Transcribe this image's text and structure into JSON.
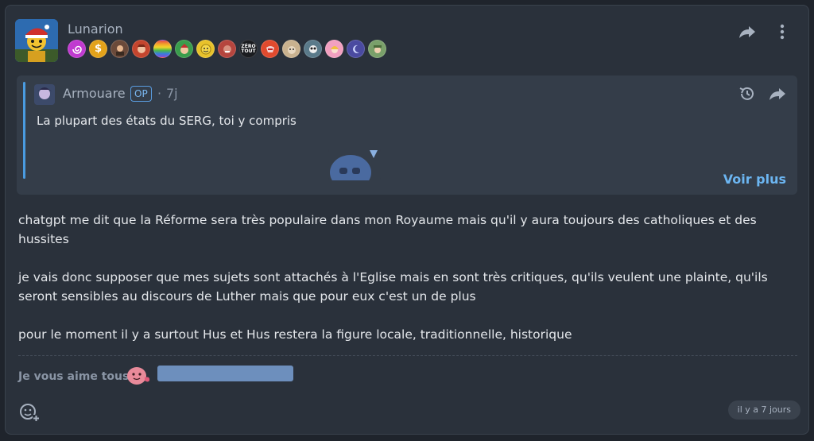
{
  "post": {
    "author": "Lunarion",
    "badges": [
      {
        "icon": "spiral-badge",
        "color": "#c03ad0",
        "label": ""
      },
      {
        "icon": "dollar-badge",
        "color": "#e3a21a",
        "label": "$"
      },
      {
        "icon": "soldier-badge",
        "color": "#6b4a3a",
        "label": ""
      },
      {
        "icon": "warrior-badge",
        "color": "#c4452e",
        "label": ""
      },
      {
        "icon": "rainbow-badge",
        "color": "#e5484d",
        "label": ""
      },
      {
        "icon": "elf-badge",
        "color": "#3a9d4c",
        "label": ""
      },
      {
        "icon": "smiley-badge",
        "color": "#e8c22b",
        "label": ""
      },
      {
        "icon": "monster-badge",
        "color": "#b5453e",
        "label": ""
      },
      {
        "icon": "zero-tout-badge",
        "color": "#1a1c20",
        "label": "ZÉRO TOUT"
      },
      {
        "icon": "flame-badge",
        "color": "#e04a2e",
        "label": ""
      },
      {
        "icon": "pet-badge",
        "color": "#c9b28f",
        "label": ""
      },
      {
        "icon": "panda-badge",
        "color": "#5a7a8a",
        "label": ""
      },
      {
        "icon": "girl-badge",
        "color": "#f2a0c0",
        "label": ""
      },
      {
        "icon": "moon-badge",
        "color": "#4a4aa0",
        "label": ""
      },
      {
        "icon": "scout-badge",
        "color": "#7aa06a",
        "label": ""
      }
    ],
    "quote": {
      "author": "Armouare",
      "op_label": "OP",
      "time": "7j",
      "text": "La plupart des états du SERG, toi y compris",
      "more_label": "Voir plus"
    },
    "paragraphs": [
      "chatgpt me dit que la Réforme sera très populaire dans mon Royaume mais qu'il y aura toujours des catholiques et des hussites",
      "je vais donc supposer que mes sujets sont attachés à l'Eglise mais en sont très critiques, qu'ils veulent une plainte, qu'ils seront sensibles au discours de Luther mais que pour eux c'est un de plus",
      "pour le moment il y a surtout Hus et Hus restera la figure locale, traditionnelle, historique"
    ],
    "signature": "Je vous aime tous",
    "timestamp": "il y a 7 jours"
  },
  "colors": {
    "background": "#1f242c",
    "card": "#2a313b",
    "quote_bg": "#343d49",
    "accent": "#6cb6f2",
    "signature_bar": "#6d8fbd"
  }
}
